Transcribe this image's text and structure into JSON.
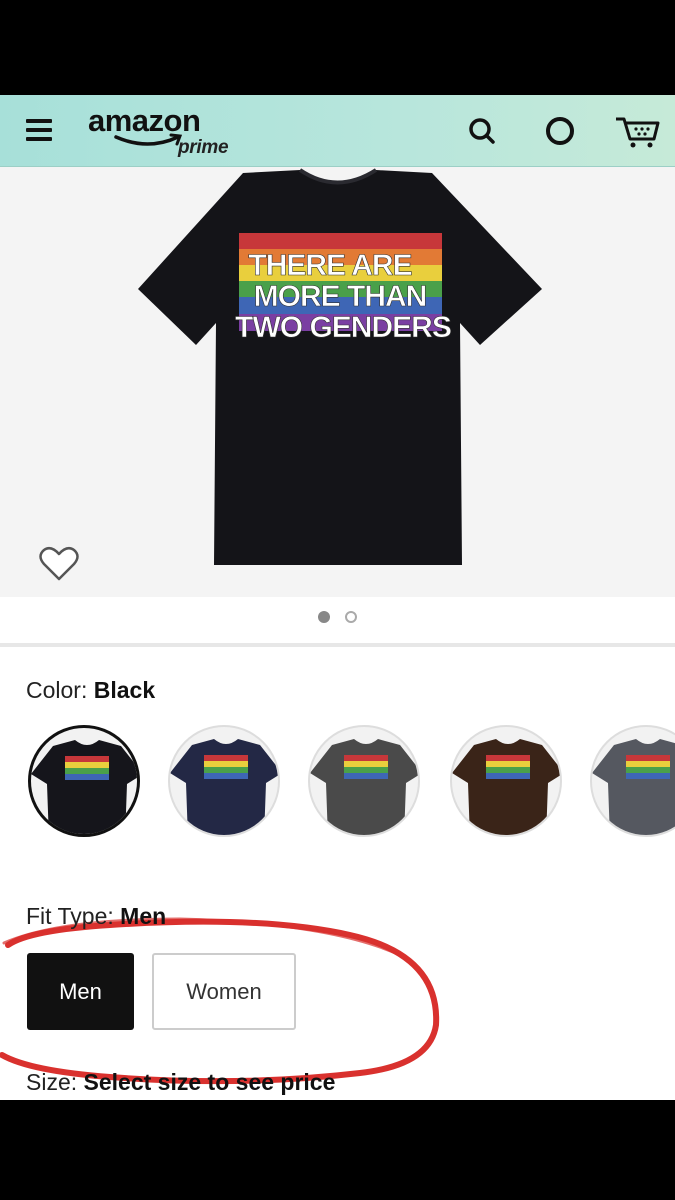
{
  "header": {
    "logo_word": "amazon",
    "logo_sub": "prime",
    "icons": [
      "menu-icon",
      "search-icon",
      "account-icon",
      "cart-icon"
    ]
  },
  "product": {
    "shirt_text_lines": [
      "THERE ARE",
      "MORE THAN",
      "TWO GENDERS"
    ],
    "image_dots": {
      "total": 2,
      "active": 1
    }
  },
  "color": {
    "label": "Color:",
    "value": "Black",
    "swatches": [
      {
        "name": "Black",
        "hex": "#15151b"
      },
      {
        "name": "Navy",
        "hex": "#232845"
      },
      {
        "name": "Dark Heather",
        "hex": "#4a4a4a"
      },
      {
        "name": "Brown",
        "hex": "#3a2418"
      },
      {
        "name": "Heather Grey",
        "hex": "#555860"
      }
    ]
  },
  "fit_type": {
    "label": "Fit Type:",
    "value": "Men",
    "options": [
      "Men",
      "Women"
    ]
  },
  "size": {
    "label": "Size:",
    "value": "Select size to see price"
  },
  "colors": {
    "header_bg": "#a7e0d9",
    "annotation": "#d9312e",
    "selected_button": "#111111"
  }
}
